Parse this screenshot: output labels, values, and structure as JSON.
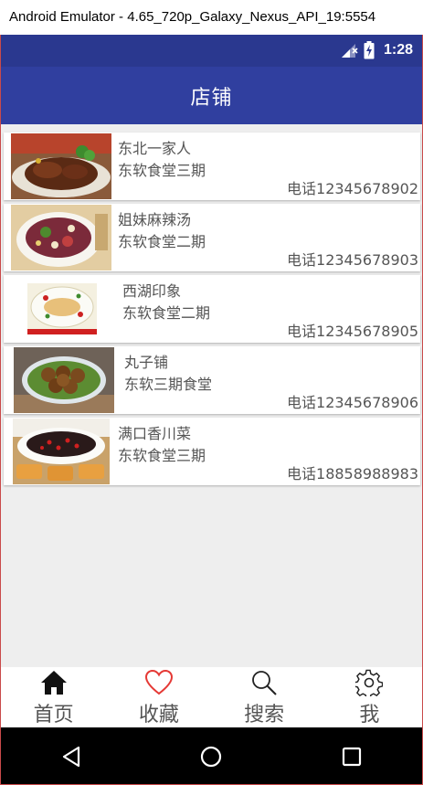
{
  "window": {
    "title": "Android Emulator - 4.65_720p_Galaxy_Nexus_API_19:5554"
  },
  "status_bar": {
    "time": "1:28",
    "icons": [
      "signal-icon",
      "battery-charging-icon"
    ]
  },
  "app_bar": {
    "title": "店铺"
  },
  "shops": [
    {
      "name": "东北一家人",
      "location": "东软食堂三期",
      "phone": "电话12345678902",
      "image": "braised-meat-dish"
    },
    {
      "name": "姐妹麻辣汤",
      "location": "东软食堂二期",
      "phone": "电话12345678903",
      "image": "spicy-soup-bowl"
    },
    {
      "name": "西湖印象",
      "location": "东软食堂二期",
      "phone": "电话12345678905",
      "image": "west-lake-plate"
    },
    {
      "name": "丸子铺",
      "location": "东软三期食堂",
      "phone": "电话12345678906",
      "image": "meatball-plate"
    },
    {
      "name": "满口香川菜",
      "location": "东软食堂三期",
      "phone": "电话18858988983",
      "image": "sichuan-dish"
    }
  ],
  "bottom_nav": [
    {
      "label": "首页",
      "icon": "home-icon",
      "active": true
    },
    {
      "label": "收藏",
      "icon": "heart-icon",
      "active": false
    },
    {
      "label": "搜索",
      "icon": "search-icon",
      "active": false
    },
    {
      "label": "我",
      "icon": "gear-icon",
      "active": false
    }
  ],
  "colors": {
    "status_bar": "#2a388f",
    "app_bar": "#303f9f",
    "content_bg": "#eeeeee",
    "text_gray": "#555555",
    "heart_red": "#e53935"
  }
}
